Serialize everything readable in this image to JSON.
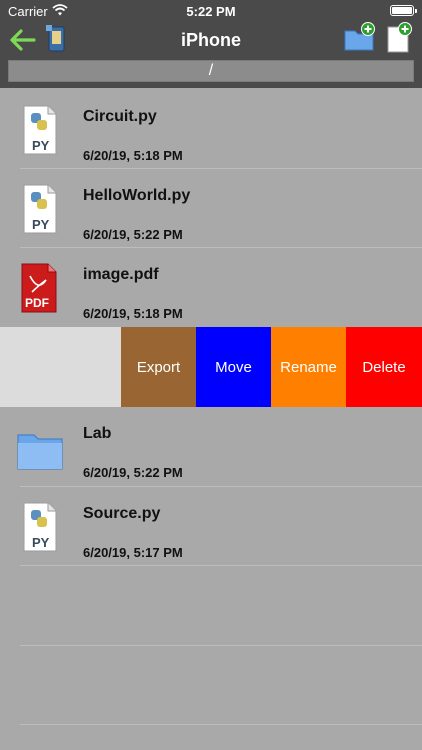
{
  "status": {
    "carrier": "Carrier",
    "time": "5:22 PM"
  },
  "nav": {
    "title": "iPhone",
    "path": "/",
    "colors": {
      "bar": "#4a4a4a",
      "back_arrow": "#7ed957"
    }
  },
  "files": [
    {
      "name": "Circuit.py",
      "date": "6/20/19, 5:18 PM",
      "icon": "python-file-icon",
      "badge": "PY"
    },
    {
      "name": "HelloWorld.py",
      "date": "6/20/19, 5:22 PM",
      "icon": "python-file-icon",
      "badge": "PY"
    },
    {
      "name": "image.pdf",
      "date": "6/20/19, 5:18 PM",
      "icon": "pdf-file-icon",
      "badge": "PDF"
    },
    {
      "name": "Lab",
      "date": "6/20/19, 5:22 PM",
      "icon": "folder-icon"
    },
    {
      "name": "Source.py",
      "date": "6/20/19, 5:17 PM",
      "icon": "python-file-icon",
      "badge": "PY"
    }
  ],
  "swipe_actions": [
    {
      "label": "Export",
      "color": "#996633"
    },
    {
      "label": "Move",
      "color": "#0000ff"
    },
    {
      "label": "Rename",
      "color": "#ff8000"
    },
    {
      "label": "Delete",
      "color": "#ff0000"
    }
  ]
}
